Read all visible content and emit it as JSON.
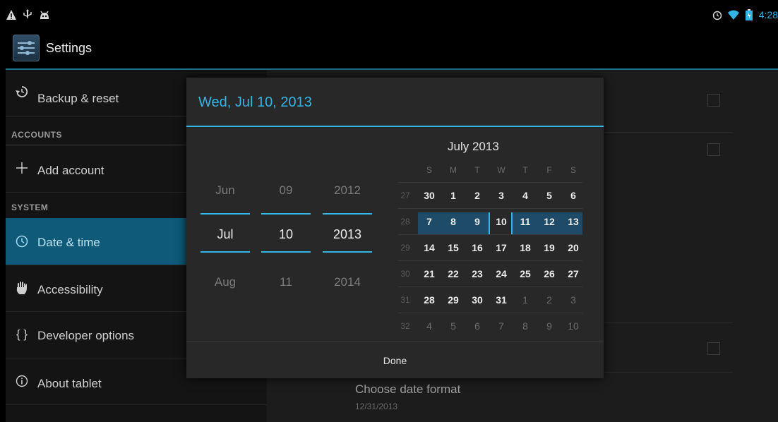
{
  "statusbar": {
    "left_icons": [
      "warning-icon",
      "usb-icon",
      "android-debug-icon"
    ],
    "right_icons": [
      "alarm-icon",
      "wifi-icon",
      "battery-icon"
    ],
    "time": "4:28"
  },
  "actionbar": {
    "title": "Settings",
    "icon": "settings-sliders-icon"
  },
  "sidebar": {
    "items": [
      {
        "type": "item",
        "label": "Backup & reset",
        "icon": "backup-restore-icon"
      },
      {
        "type": "header",
        "label": "ACCOUNTS"
      },
      {
        "type": "item",
        "label": "Add account",
        "icon": "plus-icon"
      },
      {
        "type": "header",
        "label": "SYSTEM"
      },
      {
        "type": "item",
        "label": "Date & time",
        "icon": "clock-icon",
        "selected": true
      },
      {
        "type": "item",
        "label": "Accessibility",
        "icon": "hand-icon"
      },
      {
        "type": "item",
        "label": "Developer options",
        "icon": "braces-icon"
      },
      {
        "type": "item",
        "label": "About tablet",
        "icon": "info-icon"
      }
    ]
  },
  "detail": {
    "date_format_title": "Choose date format",
    "date_format_value": "12/31/2013"
  },
  "dialog": {
    "title": "Wed, Jul 10, 2013",
    "spinners": {
      "month": {
        "prev": "Jun",
        "current": "Jul",
        "next": "Aug"
      },
      "day": {
        "prev": "09",
        "current": "10",
        "next": "11"
      },
      "year": {
        "prev": "2012",
        "current": "2013",
        "next": "2014"
      }
    },
    "calendar": {
      "month_label": "July 2013",
      "weekdays": [
        "S",
        "M",
        "T",
        "W",
        "T",
        "F",
        "S"
      ],
      "weeks": [
        {
          "week": "27",
          "days": [
            "30",
            "1",
            "2",
            "3",
            "4",
            "5",
            "6"
          ],
          "dim": [
            false,
            false,
            false,
            false,
            false,
            false,
            false
          ]
        },
        {
          "week": "28",
          "days": [
            "7",
            "8",
            "9",
            "10",
            "11",
            "12",
            "13"
          ],
          "dim": [
            false,
            false,
            false,
            false,
            false,
            false,
            false
          ]
        },
        {
          "week": "29",
          "days": [
            "14",
            "15",
            "16",
            "17",
            "18",
            "19",
            "20"
          ],
          "dim": [
            false,
            false,
            false,
            false,
            false,
            false,
            false
          ]
        },
        {
          "week": "30",
          "days": [
            "21",
            "22",
            "23",
            "24",
            "25",
            "26",
            "27"
          ],
          "dim": [
            false,
            false,
            false,
            false,
            false,
            false,
            false
          ]
        },
        {
          "week": "31",
          "days": [
            "28",
            "29",
            "30",
            "31",
            "1",
            "2",
            "3"
          ],
          "dim": [
            false,
            false,
            false,
            false,
            true,
            true,
            true
          ]
        },
        {
          "week": "32",
          "days": [
            "4",
            "5",
            "6",
            "7",
            "8",
            "9",
            "10"
          ],
          "dim": [
            true,
            true,
            true,
            true,
            true,
            true,
            true
          ]
        }
      ],
      "selected_day": "10"
    },
    "done_label": "Done"
  },
  "colors": {
    "accent": "#33b5e5",
    "selected_row": "#0e5a78",
    "week_highlight": "#1e4c68"
  }
}
